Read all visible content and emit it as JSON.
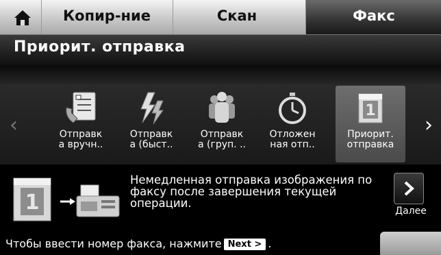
{
  "tabs": {
    "copy_label": "Копир-ние",
    "scan_label": "Скан",
    "fax_label": "Факс"
  },
  "page_title": "Приорит. отправка",
  "items": [
    {
      "line1": "Отправк",
      "line2": "а вручн..",
      "icon": "manual-send-icon"
    },
    {
      "line1": "Отправк",
      "line2": "а (быст..",
      "icon": "quick-send-icon"
    },
    {
      "line1": "Отправк",
      "line2": "а (груп. ..",
      "icon": "group-send-icon"
    },
    {
      "line1": "Отложен",
      "line2": "ная отп..",
      "icon": "delayed-send-icon"
    },
    {
      "line1": "Приорит.",
      "line2": "отправка",
      "icon": "priority-send-icon"
    }
  ],
  "description": "Немедленная отправка изображения по факсу после завершения текущей операции.",
  "next": {
    "label": "Далее"
  },
  "hint": {
    "before": "Чтобы ввести номер факса, нажмите",
    "key": "Next >",
    "after": "."
  },
  "colors": {
    "tab_active": "#333333",
    "tab_inactive": "#d0d0d0",
    "selected_item": "#5a5a5a"
  }
}
